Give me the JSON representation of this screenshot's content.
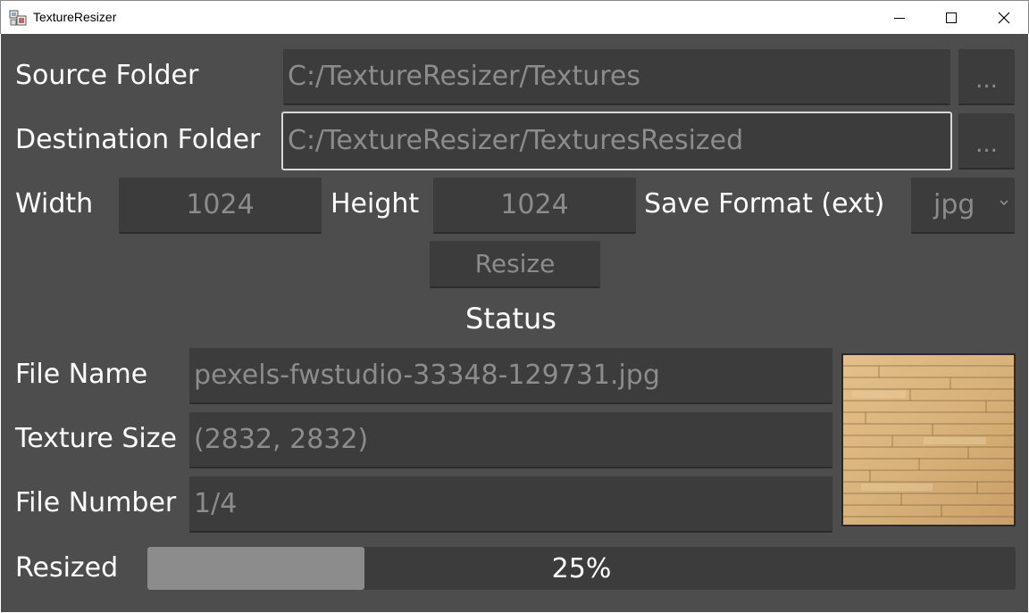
{
  "window": {
    "title": "TextureResizer",
    "controls": {
      "minimize": "minimize-icon",
      "maximize": "maximize-icon",
      "close": "close-icon"
    }
  },
  "form": {
    "source_label": "Source Folder",
    "source_value": "C:/TextureResizer/Textures",
    "source_browse": "...",
    "destination_label": "Destination Folder",
    "destination_value": "C:/TextureResizer/TexturesResized",
    "destination_browse": "...",
    "width_label": "Width",
    "width_value": "1024",
    "height_label": "Height",
    "height_value": "1024",
    "format_label": "Save Format (ext)",
    "format_value": "jpg",
    "resize_button": "Resize"
  },
  "status": {
    "heading": "Status",
    "file_name_label": "File Name",
    "file_name_value": "pexels-fwstudio-33348-129731.jpg",
    "texture_size_label": "Texture Size",
    "texture_size_value": "(2832, 2832)",
    "file_number_label": "File Number",
    "file_number_value": "1/4",
    "resized_label": "Resized",
    "progress_value": 0.25,
    "progress_text": "25%"
  },
  "colors": {
    "background": "#4d4d4d",
    "field": "#3c3c3c",
    "field_text": "#8c8c8c",
    "label_text": "#ffffff",
    "progress_fill": "#8c8c8c"
  }
}
